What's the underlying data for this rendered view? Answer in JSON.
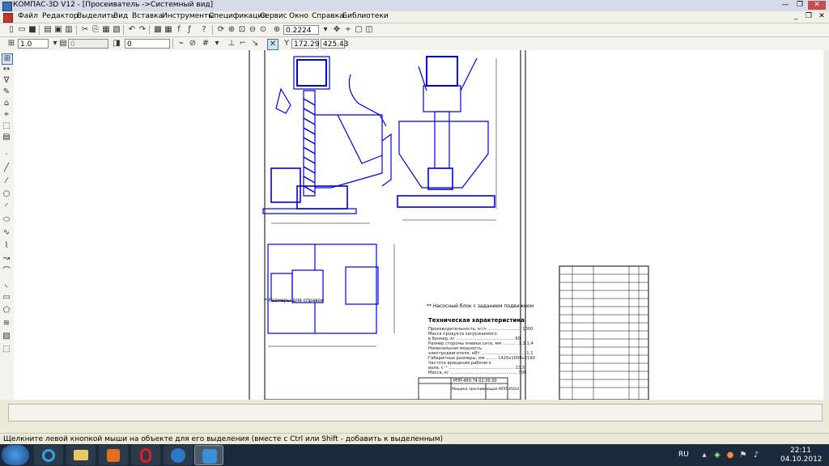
{
  "window": {
    "title": "КОМПАС-3D V12 - [Просеиватель ->Системный вид]"
  },
  "menu": {
    "items": [
      "Файл",
      "Редактор",
      "Выделить",
      "Вид",
      "Вставка",
      "Инструменты",
      "Спецификация",
      "Сервис",
      "Окно",
      "Справка",
      "Библиотеки"
    ]
  },
  "toolbar1": {
    "zoom_value": "0.2224"
  },
  "toolbar2": {
    "line_scale": "1.0",
    "layer_style": "0",
    "layer_num": "0",
    "coord_x": "172.29",
    "coord_y": "425.43"
  },
  "drawing": {
    "notes_line1": "* Размеры для справок",
    "notes_line2": "** Насосный блок с заданием подвижном",
    "tech_header": "Техническая характеристика",
    "tech_lines": [
      "Производительность, кг/ч ......................... 1000",
      "Масса продукта загружаемого",
      "в бункер, кг ........................................... 60",
      "Размер стороны ячейки сита, мм ........... 1,2  1,4",
      "Номинальная мощность",
      "электродвигателя, кВт ................................. 1,1",
      "Габаритные размеры, мм ........ 1420х1000х2160",
      "Частота вращения рабочего",
      "вала, с⁻¹ ................................................. 23,5",
      "Масса, кг .................................................. 300"
    ],
    "stamp_code": "РПП-450.74.02.00.00",
    "stamp_name": "Машина просеивающая МПП-450/4"
  },
  "status": {
    "hint": "Щелкните левой кнопкой мыши на объекте для его выделения (вместе с Ctrl или Shift - добавить к выделенным)"
  },
  "taskbar": {
    "lang": "RU",
    "time": "22:11",
    "date": "04.10.2012"
  },
  "colors": {
    "drawing_blue": "#0000dd",
    "taskbar": "#1b2b3c"
  }
}
